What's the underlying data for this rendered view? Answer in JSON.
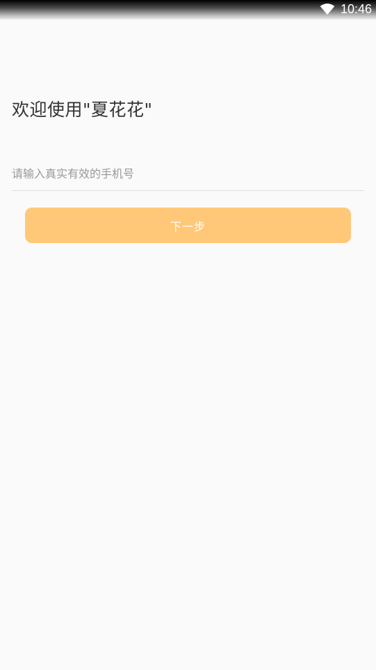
{
  "status_bar": {
    "time": "10:46",
    "wifi_icon": "wifi-icon"
  },
  "main": {
    "title": "欢迎使用\"夏花花\"",
    "phone_placeholder": "请输入真实有效的手机号",
    "next_label": "下一步"
  },
  "colors": {
    "accent": "#ffc878",
    "background": "#fafafa",
    "title_text": "#333333",
    "placeholder_text": "#999999"
  }
}
